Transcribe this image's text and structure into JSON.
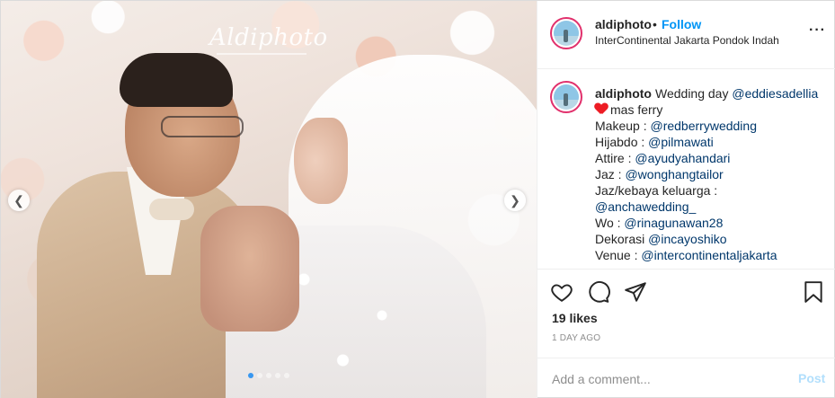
{
  "media": {
    "watermark": "Aldiphoto",
    "slide_count": 5,
    "active_slide": 1
  },
  "header": {
    "username": "aldiphoto",
    "separator": "•",
    "follow_label": "Follow",
    "location": "InterContinental Jakarta Pondok Indah",
    "more_icon": "more-dots-icon"
  },
  "caption": {
    "username": "aldiphoto",
    "lines": [
      {
        "prefix": "Wedding day ",
        "mention": "@eddiesadellia"
      },
      {
        "heart": true,
        "text": "mas ferry"
      },
      {
        "prefix": "Makeup : ",
        "mention": "@redberrywedding"
      },
      {
        "prefix": "Hijabdo : ",
        "mention": "@pilmawati"
      },
      {
        "prefix": "Attire : ",
        "mention": "@ayudyahandari"
      },
      {
        "prefix": "Jaz : ",
        "mention": "@wonghangtailor"
      },
      {
        "prefix": "Jaz/kebaya keluarga :",
        "mention": ""
      },
      {
        "prefix": "",
        "mention": "@anchawedding_"
      },
      {
        "prefix": "Wo : ",
        "mention": "@rinagunawan28"
      },
      {
        "prefix": "Dekorasi ",
        "mention": "@incayoshiko"
      },
      {
        "prefix": "Venue : ",
        "mention": "@intercontinentaljakarta"
      }
    ]
  },
  "actions": {
    "like_icon": "heart-outline-icon",
    "comment_icon": "comment-icon",
    "share_icon": "share-icon",
    "save_icon": "bookmark-icon"
  },
  "likes": "19 likes",
  "time_ago": "1 DAY AGO",
  "comment": {
    "placeholder": "Add a comment...",
    "post_label": "Post"
  },
  "colors": {
    "accent": "#0095f6",
    "post_disabled": "#b2dffc",
    "heart": "#ed1c24",
    "active_dot": "#3897f0"
  }
}
